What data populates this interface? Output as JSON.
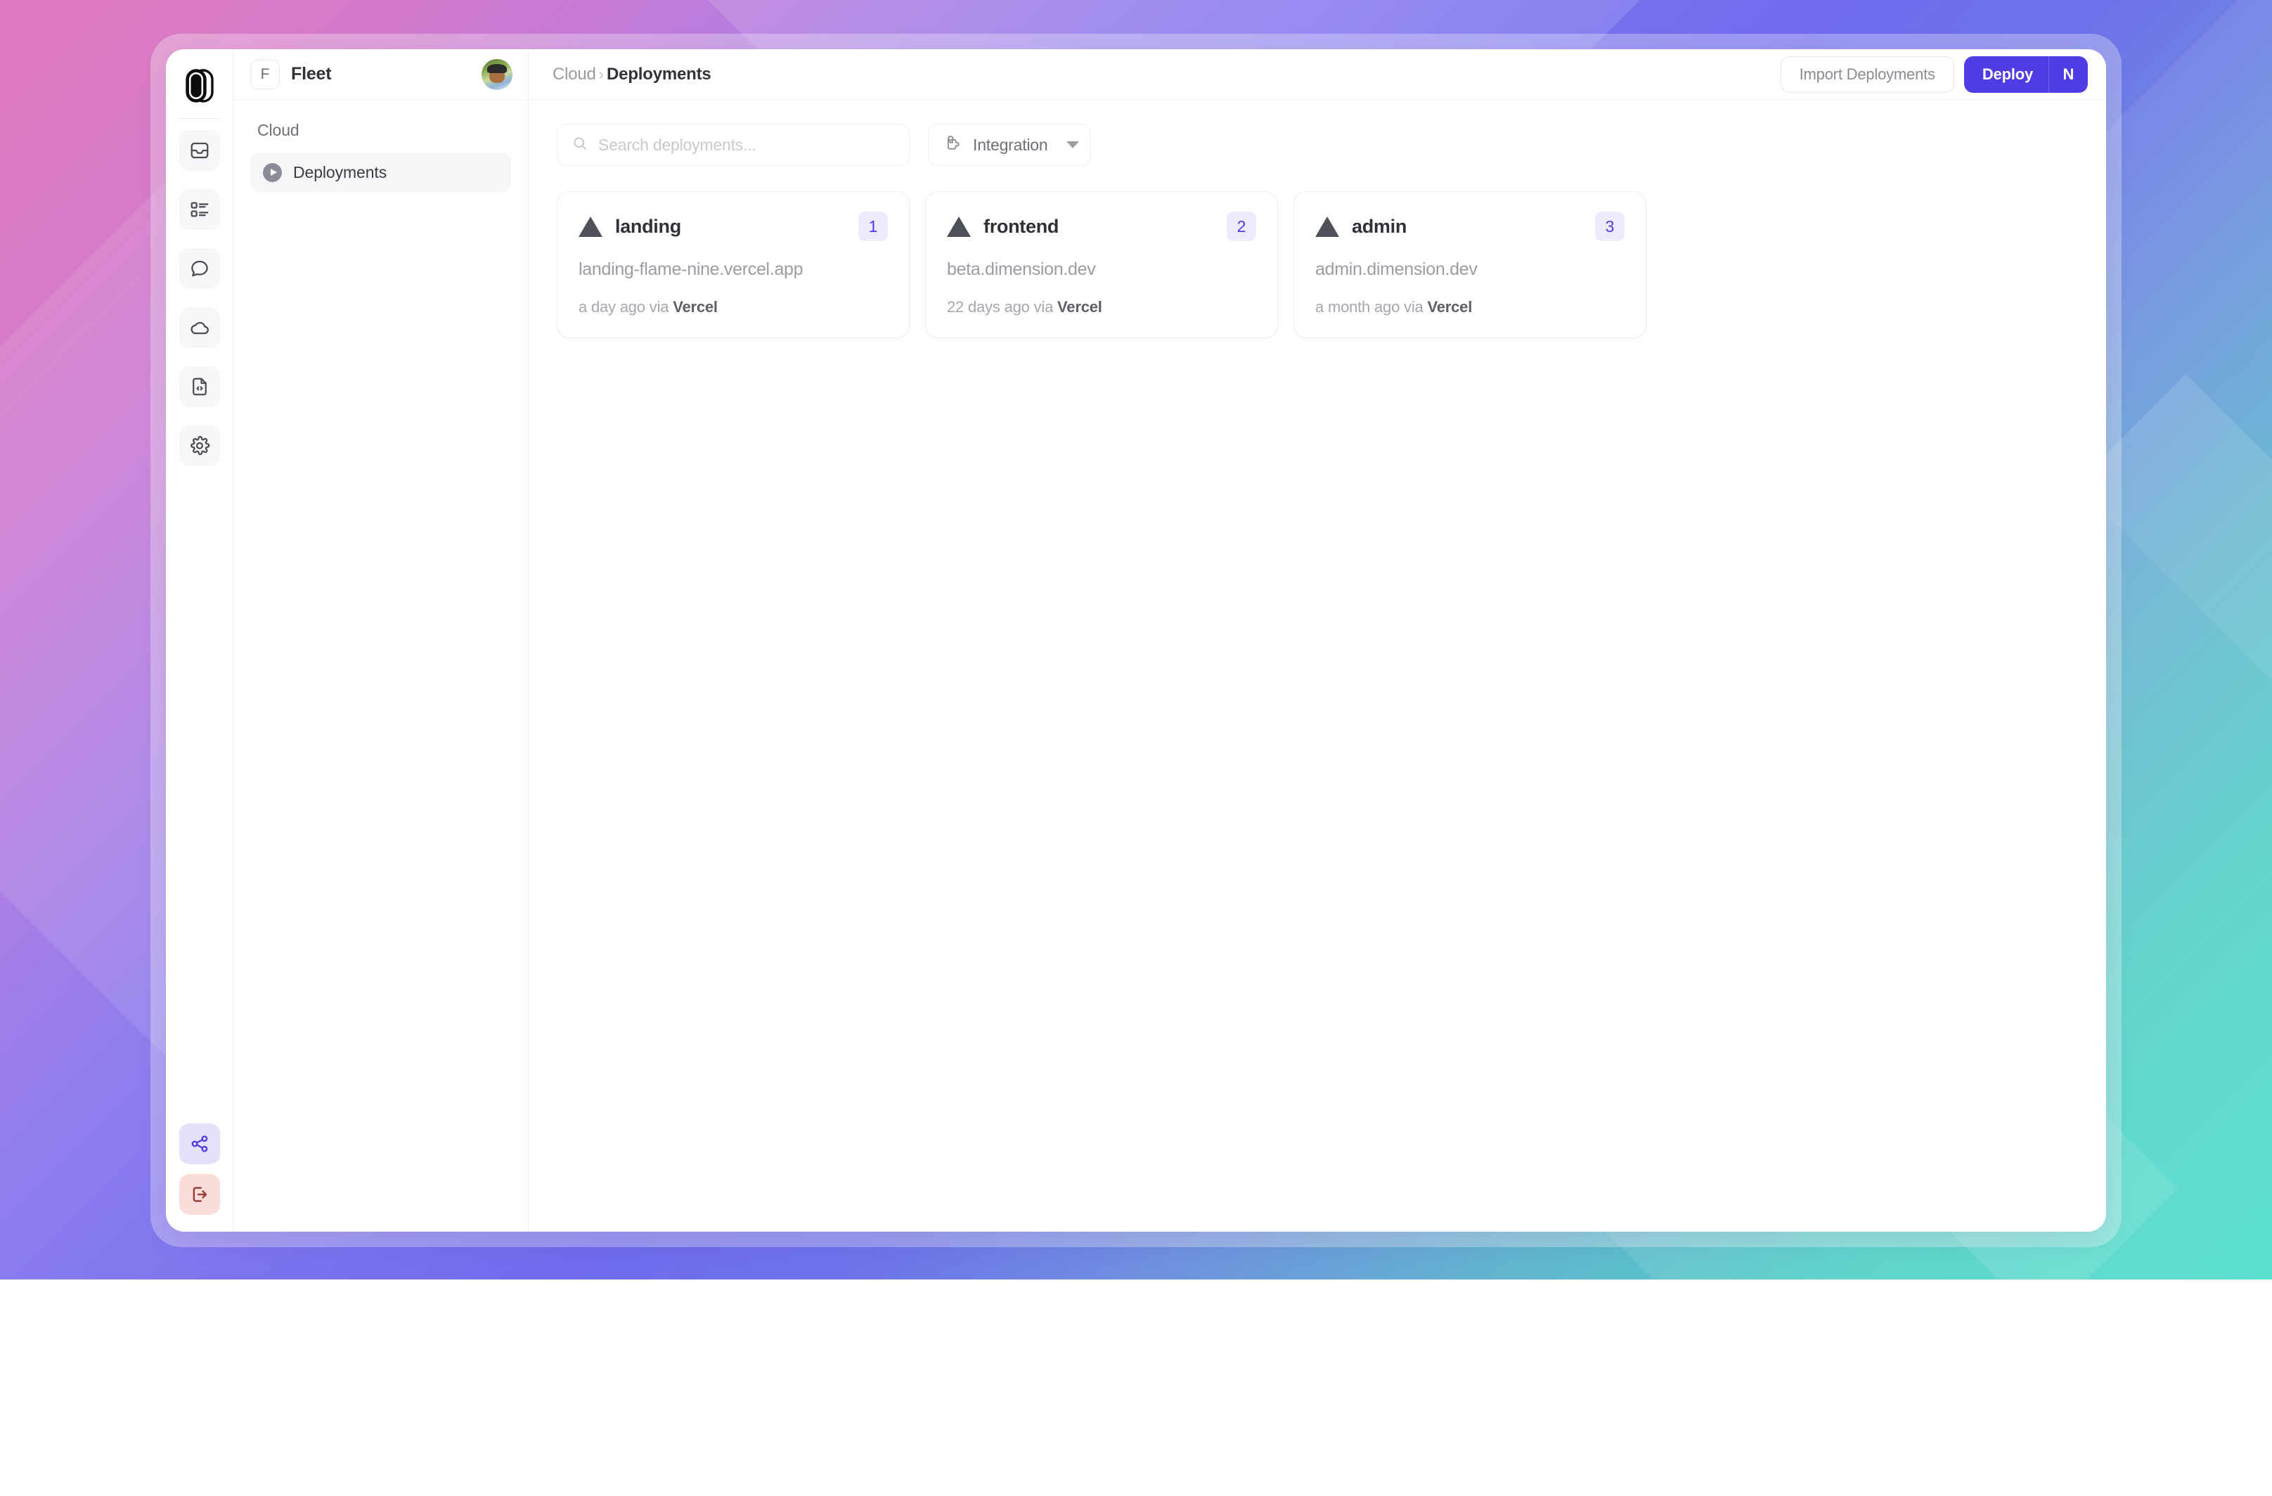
{
  "theme": {
    "accent": "#4f3ce4",
    "accent_soft_bg": "#eceafc",
    "danger_soft_bg": "#fbdedb",
    "rail_icon_bg": "#f7f7f9",
    "text_primary": "#2f3038",
    "text_muted": "#9c9ca6",
    "border": "#eeeef1"
  },
  "rail": {
    "logo_name": "app-logo",
    "items": [
      {
        "name": "inbox-icon",
        "label": "Inbox"
      },
      {
        "name": "list-icon",
        "label": "Lists"
      },
      {
        "name": "chat-bubble-icon",
        "label": "Chat"
      },
      {
        "name": "cloud-icon",
        "label": "Cloud"
      },
      {
        "name": "file-code-icon",
        "label": "Docs"
      },
      {
        "name": "gear-icon",
        "label": "Settings"
      }
    ],
    "bottom_items": [
      {
        "name": "share-icon",
        "label": "Share"
      },
      {
        "name": "logout-icon",
        "label": "Log out"
      }
    ]
  },
  "sidebar": {
    "workspace_initial": "F",
    "workspace_name": "Fleet",
    "avatar_name": "user-avatar",
    "section_label": "Cloud",
    "items": [
      {
        "label": "Deployments",
        "active": true,
        "icon": "play-circle-icon"
      }
    ]
  },
  "topbar": {
    "breadcrumb": {
      "parent": "Cloud",
      "separator": "›",
      "current": "Deployments"
    },
    "import_label": "Import Deployments",
    "deploy_label": "Deploy",
    "deploy_shortcut": "N"
  },
  "filters": {
    "search_placeholder": "Search deployments...",
    "search_value": "",
    "integration_label": "Integration",
    "integration_icon": "integration-icon"
  },
  "deployments": [
    {
      "provider_icon": "vercel-triangle-icon",
      "name": "landing",
      "count": "1",
      "url": "landing-flame-nine.vercel.app",
      "time_text": "a day ago via ",
      "provider": "Vercel"
    },
    {
      "provider_icon": "vercel-triangle-icon",
      "name": "frontend",
      "count": "2",
      "url": "beta.dimension.dev",
      "time_text": "22 days ago via ",
      "provider": "Vercel"
    },
    {
      "provider_icon": "vercel-triangle-icon",
      "name": "admin",
      "count": "3",
      "url": "admin.dimension.dev",
      "time_text": "a month ago via ",
      "provider": "Vercel"
    }
  ]
}
